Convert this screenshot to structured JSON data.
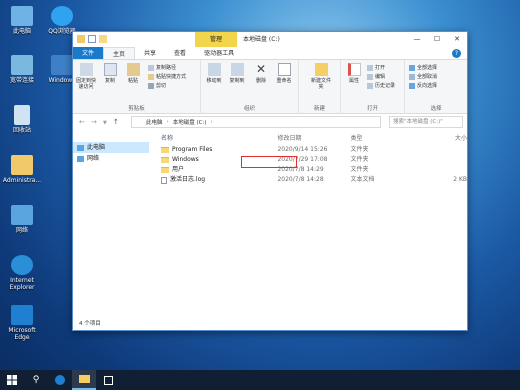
{
  "desktop": {
    "icons": [
      {
        "label": "此电脑"
      },
      {
        "label": "QQ浏览器"
      },
      {
        "label": "宽带连接"
      },
      {
        "label": "Windows"
      },
      {
        "label": "回收站"
      },
      {
        "label": "Administra..."
      },
      {
        "label": "网络"
      },
      {
        "label": "Internet Explorer"
      },
      {
        "label": "Microsoft Edge"
      }
    ]
  },
  "window": {
    "title": "本地磁盘 (C:)",
    "manage_tab": "管理",
    "ribbon_tabs": [
      "文件",
      "主页",
      "共享",
      "查看",
      "驱动器工具"
    ],
    "groups": {
      "clipboard": {
        "name": "剪贴板",
        "pin": "固定到快速访问",
        "copy": "复制",
        "paste": "粘贴",
        "copy_path": "复制路径",
        "paste_shortcut": "粘贴快捷方式",
        "cut": "剪切"
      },
      "organize": {
        "name": "组织",
        "move_to": "移动到",
        "copy_to": "复制到",
        "delete": "删除",
        "rename": "重命名"
      },
      "new": {
        "name": "新建",
        "new_folder": "新建文件夹"
      },
      "open": {
        "name": "打开",
        "properties": "属性",
        "open": "打开",
        "edit": "编辑",
        "history": "历史记录"
      },
      "select": {
        "name": "选择",
        "select_all": "全部选择",
        "select_none": "全部取消",
        "invert": "反向选择"
      }
    },
    "breadcrumb": [
      "此电脑",
      "本地磁盘 (C:)"
    ],
    "search_placeholder": "搜索\"本地磁盘 (C:)\"",
    "nav": [
      {
        "label": "此电脑"
      },
      {
        "label": "网络"
      }
    ],
    "columns": [
      "名称",
      "修改日期",
      "类型",
      "大小"
    ],
    "files": [
      {
        "name": "Program Files",
        "date": "2020/9/14 15:26",
        "type": "文件夹",
        "size": ""
      },
      {
        "name": "Windows",
        "date": "2020/7/29 17:08",
        "type": "文件夹",
        "size": ""
      },
      {
        "name": "用户",
        "date": "2020/7/8 14:29",
        "type": "文件夹",
        "size": ""
      },
      {
        "name": "激活日志.log",
        "date": "2020/7/8 14:28",
        "type": "文本文档",
        "size": "2 KB"
      }
    ],
    "status": "4 个项目"
  }
}
